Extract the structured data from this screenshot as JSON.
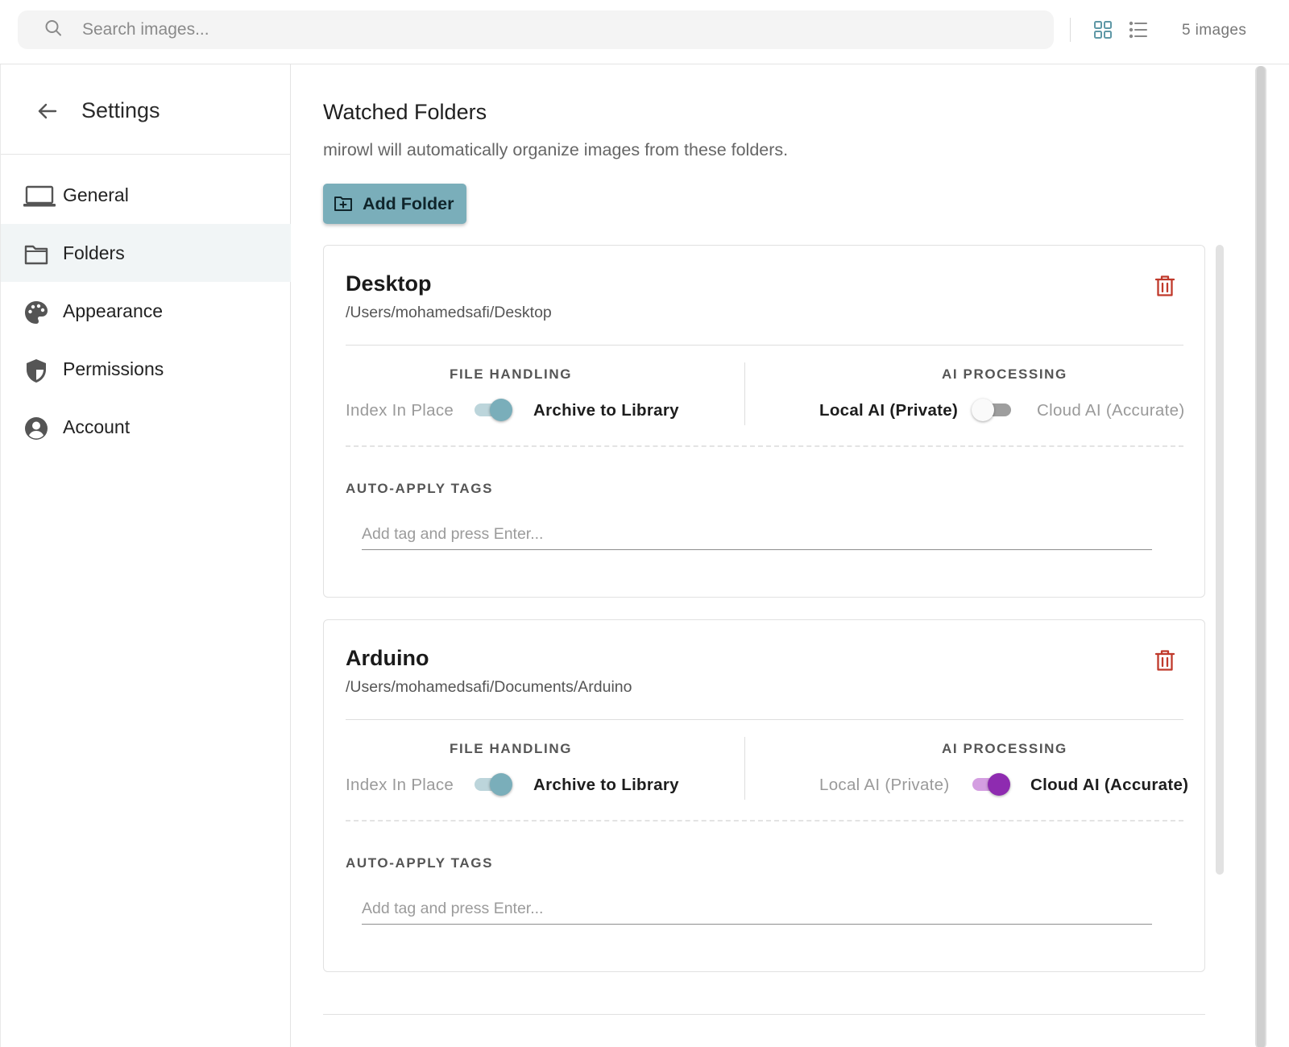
{
  "topbar": {
    "search_placeholder": "Search images...",
    "image_count": "5 images",
    "icons": {
      "search": "search-icon",
      "grid": "grid-view-icon",
      "list": "list-view-icon"
    }
  },
  "sidebar": {
    "title": "Settings",
    "active": "Folders",
    "items": [
      {
        "label": "General",
        "icon": "laptop-icon"
      },
      {
        "label": "Folders",
        "icon": "folder-icon"
      },
      {
        "label": "Appearance",
        "icon": "palette-icon"
      },
      {
        "label": "Permissions",
        "icon": "shield-icon"
      },
      {
        "label": "Account",
        "icon": "account-circle-icon"
      }
    ]
  },
  "main": {
    "title": "Watched Folders",
    "subtitle": "mirowl will automatically organize images from these folders.",
    "add_button": "Add Folder",
    "file_handling_label": "FILE HANDLING",
    "ai_processing_label": "AI PROCESSING",
    "index_in_place": "Index In Place",
    "archive_to_library": "Archive to Library",
    "local_ai": "Local AI (Private)",
    "cloud_ai": "Cloud AI (Accurate)",
    "tags_label": "AUTO-APPLY TAGS",
    "tags_placeholder": "Add tag and press Enter...",
    "folders": [
      {
        "name": "Desktop",
        "path": "/Users/mohamedsafi/Desktop",
        "archive_to_library": true,
        "cloud_ai": false
      },
      {
        "name": "Arduino",
        "path": "/Users/mohamedsafi/Documents/Arduino",
        "archive_to_library": true,
        "cloud_ai": true
      }
    ]
  },
  "colors": {
    "accent": "#7aaeba",
    "cloud_ai_accent": "#8e2bb0",
    "delete_red": "#c0392b"
  }
}
